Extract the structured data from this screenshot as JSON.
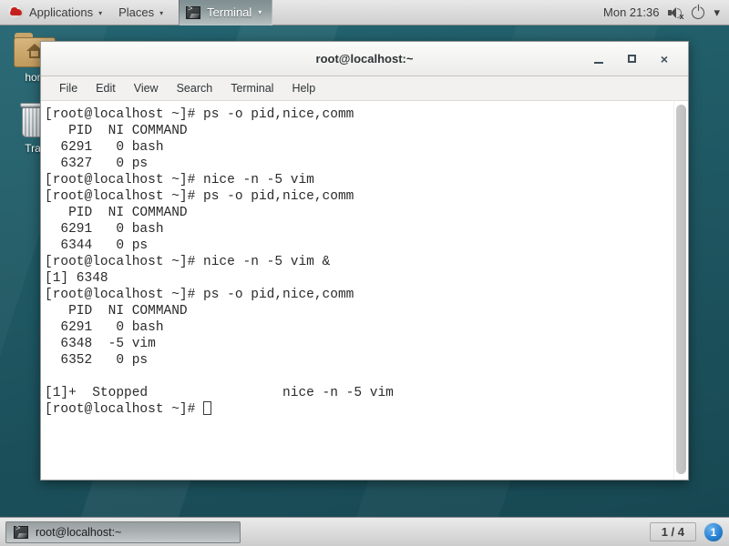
{
  "top_panel": {
    "logo_icon": "redhat-logo-icon",
    "applications_label": "Applications",
    "places_label": "Places",
    "window_menu_label": "Terminal",
    "clock": "Mon 21:36",
    "volume_icon": "speaker-muted-icon",
    "power_icon": "power-icon",
    "power_caret": "▾",
    "caret": "▾"
  },
  "desktop": {
    "icons": [
      {
        "name": "home-folder-icon",
        "label": "hom"
      },
      {
        "name": "trash-icon",
        "label": "Tras"
      }
    ],
    "background_color": "#1d545f"
  },
  "terminal_window": {
    "title": "root@localhost:~",
    "window_buttons": {
      "minimize": "minimize-button",
      "maximize": "maximize-button",
      "close": "×"
    },
    "menubar": [
      {
        "label": "File"
      },
      {
        "label": "Edit"
      },
      {
        "label": "View"
      },
      {
        "label": "Search"
      },
      {
        "label": "Terminal"
      },
      {
        "label": "Help"
      }
    ],
    "content": "[root@localhost ~]# ps -o pid,nice,comm\n   PID  NI COMMAND\n  6291   0 bash\n  6327   0 ps\n[root@localhost ~]# nice -n -5 vim\n[root@localhost ~]# ps -o pid,nice,comm\n   PID  NI COMMAND\n  6291   0 bash\n  6344   0 ps\n[root@localhost ~]# nice -n -5 vim &\n[1] 6348\n[root@localhost ~]# ps -o pid,nice,comm\n   PID  NI COMMAND\n  6291   0 bash\n  6348  -5 vim\n  6352   0 ps\n\n[1]+  Stopped                 nice -n -5 vim\n[root@localhost ~]# ",
    "text_color": "#2a2a2a",
    "background_color": "#ffffff"
  },
  "taskbar": {
    "window_button_label": "root@localhost:~",
    "window_button_icon": "terminal-icon",
    "workspace_indicator": "1 / 4",
    "notification_count": "1"
  }
}
